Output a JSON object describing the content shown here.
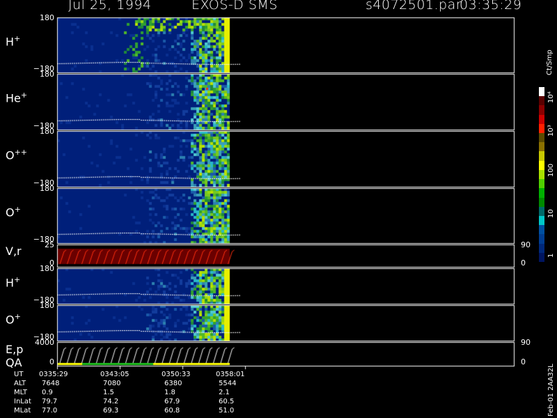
{
  "header": {
    "date": "Jul 25, 1994",
    "instrument": "EXOS-D SMS",
    "file": "s4072501.par",
    "time": "03:35:29"
  },
  "colorbar": {
    "unit_label": "Ct/Smp",
    "tick_labels": [
      "10⁴",
      "10³",
      "100",
      "10",
      "1"
    ],
    "colors": [
      "#ffffff",
      "#5a0000",
      "#8b0000",
      "#cc0000",
      "#ff2000",
      "#5a4a00",
      "#8a7000",
      "#c8c800",
      "#ffff00",
      "#a8e000",
      "#50d000",
      "#00b000",
      "#008a00",
      "#006a6a",
      "#00c8c8",
      "#0050a0",
      "#003c90",
      "#00287a",
      "#001560"
    ]
  },
  "panels": [
    {
      "label": "H",
      "sup": "+",
      "ytop": "180",
      "ybot": "−180",
      "type": "spec"
    },
    {
      "label": "He",
      "sup": "+",
      "ytop": "180",
      "ybot": "−180",
      "type": "spec"
    },
    {
      "label": "O",
      "sup": "++",
      "ytop": "180",
      "ybot": "−180",
      "type": "spec"
    },
    {
      "label": "O",
      "sup": "+",
      "ytop": "180",
      "ybot": "−180",
      "type": "spec"
    },
    {
      "label": "V,r",
      "sup": "",
      "ytop": "25",
      "ybot": "0",
      "rtop": "90",
      "rbot": "0",
      "type": "line"
    },
    {
      "label": "H",
      "sup": "+",
      "ytop": "180",
      "ybot": "−180",
      "type": "spec"
    },
    {
      "label": "O",
      "sup": "+",
      "ytop": "180",
      "ybot": "−180",
      "type": "spec"
    },
    {
      "label": "E,p",
      "label2": "QA",
      "sup": "",
      "ytop": "4000",
      "ybot": "0",
      "rtop": "90",
      "rbot": "0",
      "type": "line"
    }
  ],
  "ephemeris": [
    {
      "name": "UT",
      "values": [
        "0335:29",
        "0343:05",
        "0350:33",
        "0358:01"
      ]
    },
    {
      "name": "ALT",
      "values": [
        "7648",
        "7080",
        "6380",
        "5544"
      ]
    },
    {
      "name": "MLT",
      "values": [
        "0.9",
        "1.5",
        "1.8",
        "2.1"
      ]
    },
    {
      "name": "InLat",
      "values": [
        "79.7",
        "74.2",
        "67.9",
        "60.5"
      ]
    },
    {
      "name": "MLat",
      "values": [
        "77.0",
        "69.3",
        "60.8",
        "51.0"
      ]
    }
  ],
  "footer_vertical": "Feb-01 2AA32L",
  "chart_data": {
    "type": "heatmap",
    "title": "Jul 25, 1994   EXOS-D SMS",
    "xlabel": "UT",
    "x_ticks": [
      "0335:29",
      "0343:05",
      "0350:33",
      "0358:01"
    ],
    "series": [
      {
        "name": "H+",
        "ylim": [
          -180,
          180
        ]
      },
      {
        "name": "He+",
        "ylim": [
          -180,
          180
        ]
      },
      {
        "name": "O++",
        "ylim": [
          -180,
          180
        ]
      },
      {
        "name": "O+",
        "ylim": [
          -180,
          180
        ]
      },
      {
        "name": "V,r",
        "ylim": [
          0,
          25
        ]
      },
      {
        "name": "H+",
        "ylim": [
          -180,
          180
        ]
      },
      {
        "name": "O+",
        "ylim": [
          -180,
          180
        ]
      },
      {
        "name": "E,p",
        "ylim": [
          0,
          4000
        ]
      }
    ],
    "colorscale": {
      "label": "Ct/Smp",
      "range": [
        1,
        10000
      ],
      "scale": "log"
    }
  }
}
